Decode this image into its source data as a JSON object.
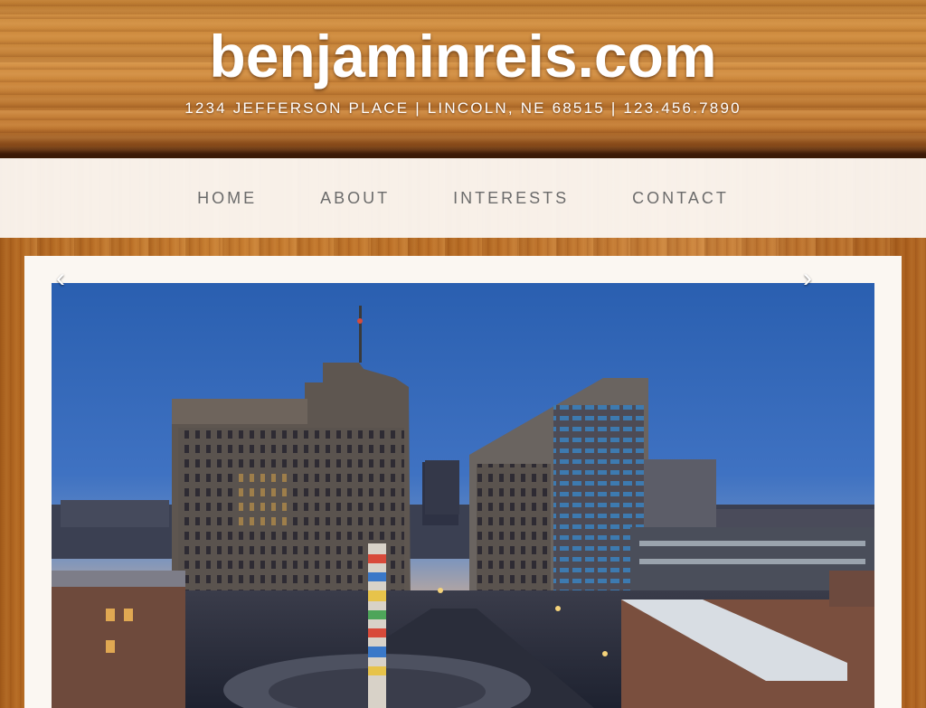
{
  "header": {
    "site_title": "benjaminreis.com",
    "contact_line": "1234 JEFFERSON PLACE | LINCOLN, NE 68515 | 123.456.7890"
  },
  "nav": {
    "items": [
      {
        "label": "HOME"
      },
      {
        "label": "ABOUT"
      },
      {
        "label": "INTERESTS"
      },
      {
        "label": "CONTACT"
      }
    ]
  },
  "slider": {
    "prev_arrow": "‹",
    "next_arrow": "›",
    "photo_subject": "city-skyline-at-dusk"
  },
  "colors": {
    "nav_text": "#6b6b6b",
    "title_text": "#ffffff",
    "card_bg": "#fbf7f2"
  }
}
